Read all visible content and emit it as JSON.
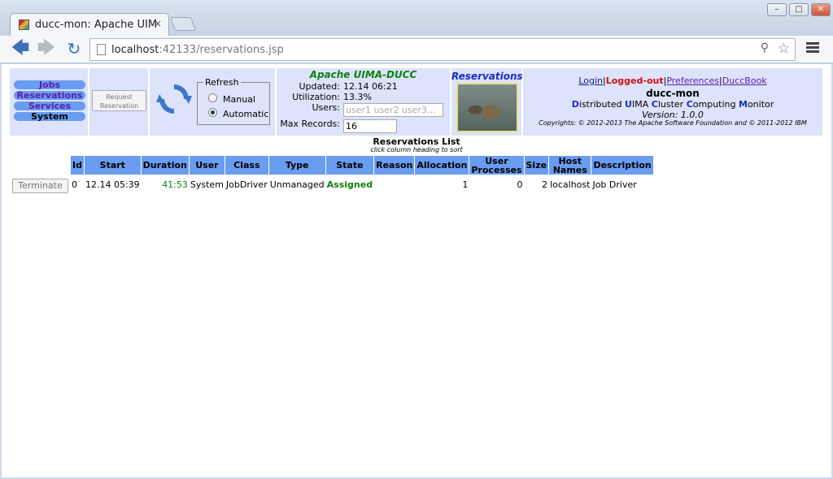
{
  "browser": {
    "tab_title": "ducc-mon: Apache UIMA-DUCC",
    "tab_close": "×",
    "url_host": "localhost",
    "url_path": ":42133/reservations.jsp",
    "window_minimize": "–",
    "window_maximize": "□",
    "window_close": "✕"
  },
  "nav": {
    "items": [
      "Jobs",
      "Reservations",
      "Services",
      "System"
    ]
  },
  "request_button": {
    "line1": "Request",
    "line2": "Reservation"
  },
  "refresh": {
    "legend": "Refresh",
    "options": [
      "Manual",
      "Automatic"
    ],
    "selected": "Automatic"
  },
  "info": {
    "title": "Apache UIMA-DUCC",
    "updated_label": "Updated:",
    "updated_value": "12.14 06:21",
    "utilization_label": "Utilization:",
    "utilization_value": "13.3%",
    "users_label": "Users:",
    "users_placeholder": "user1 user2 user3...",
    "max_records_label": "Max Records:",
    "max_records_value": "16"
  },
  "page_heading": "Reservations",
  "header_links": {
    "login": "Login",
    "logged_out": "Logged-out",
    "preferences": "Preferences",
    "duccbook": "DuccBook",
    "separator": "|"
  },
  "hostname": "ducc-mon",
  "tagline": {
    "d": "D",
    "istributed": "istributed ",
    "u": "U",
    "ima_prefix": "IMA ",
    "c": "C",
    "luster": "luster ",
    "c2": "C",
    "omputing": "omputing ",
    "m": "M",
    "onitor": "onitor"
  },
  "version": "Version: 1.0.0",
  "copyright": "Copyrights: © 2012-2013 The Apache Software Foundation and © 2011-2012 IBM",
  "list": {
    "title": "Reservations List",
    "subtitle": "click column heading to sort",
    "columns": [
      "Id",
      "Start",
      "Duration",
      "User",
      "Class",
      "Type",
      "State",
      "Reason",
      "Allocation",
      "User Processes",
      "Size",
      "Host Names",
      "Description"
    ],
    "rows": [
      {
        "action": "Terminate",
        "id": "0",
        "start": "12.14 05:39",
        "duration": "41:53",
        "user": "System",
        "class": "JobDriver",
        "type": "Unmanaged",
        "state": "Assigned",
        "reason": "",
        "allocation": "1",
        "user_processes": "0",
        "size": "2",
        "host_names": "localhost",
        "description": "Job Driver"
      }
    ]
  },
  "colors": {
    "nav_pill": "#6a9cf0",
    "header_bg": "#dde3fb",
    "state_assigned": "#108010",
    "logged_out": "#d01010"
  }
}
